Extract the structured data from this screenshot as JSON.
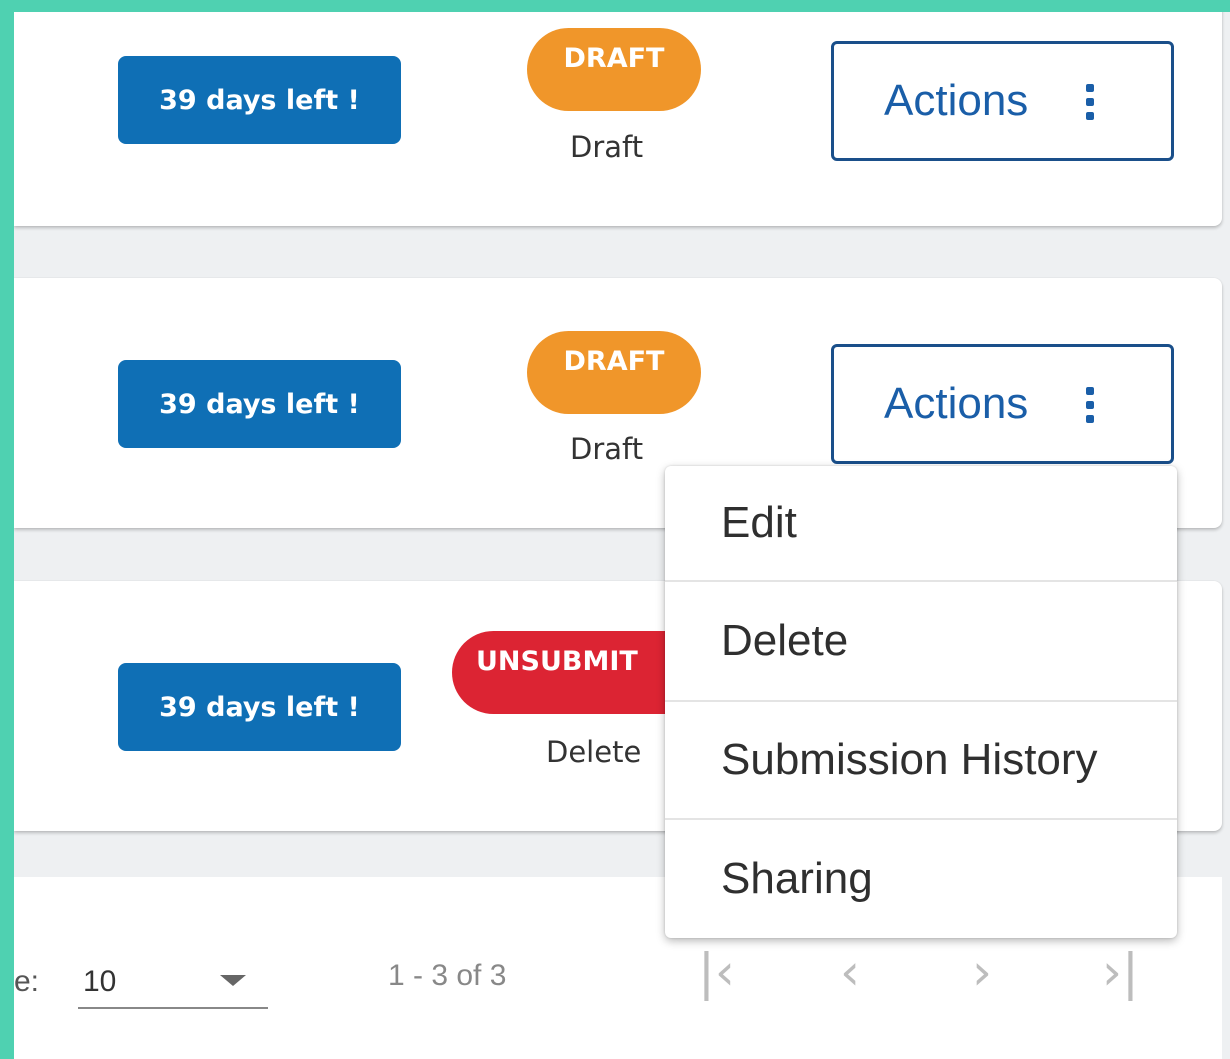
{
  "rows": [
    {
      "days_left": "39 days left !",
      "status_badge": "DRAFT",
      "status_text": "Draft",
      "actions_label": "Actions"
    },
    {
      "days_left": "39 days left !",
      "status_badge": "DRAFT",
      "status_text": "Draft",
      "actions_label": "Actions"
    },
    {
      "days_left": "39 days left !",
      "status_badge": "UNSUBMIT",
      "status_text": "Delete"
    }
  ],
  "actions_menu": {
    "items": [
      "Edit",
      "Delete",
      "Submission History",
      "Sharing"
    ]
  },
  "pagination": {
    "per_page_label": "e:",
    "per_page_value": "10",
    "range_text": "1 - 3 of 3",
    "first_icon": "first-page-icon",
    "prev_icon": "chevron-left-icon",
    "next_icon": "chevron-right-icon",
    "last_icon": "last-page-icon"
  },
  "colors": {
    "days_badge": "#0f6fb5",
    "draft_badge": "#f0962a",
    "unsubmit_badge": "#dc2433",
    "actions_border": "#1a4f8a",
    "frame": "#4fd1b1"
  }
}
